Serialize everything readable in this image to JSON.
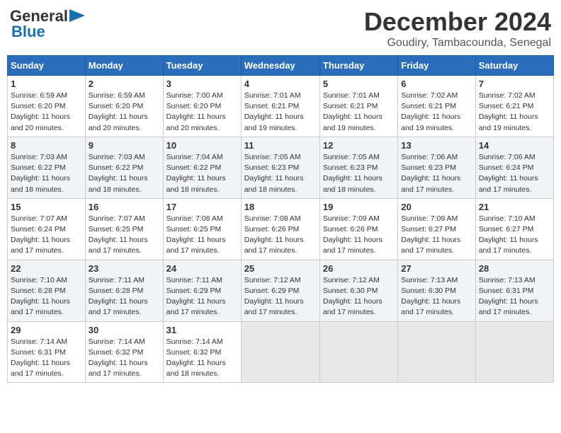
{
  "header": {
    "logo_general": "General",
    "logo_blue": "Blue",
    "month_title": "December 2024",
    "location": "Goudiry, Tambacounda, Senegal"
  },
  "days_of_week": [
    "Sunday",
    "Monday",
    "Tuesday",
    "Wednesday",
    "Thursday",
    "Friday",
    "Saturday"
  ],
  "weeks": [
    [
      {
        "day": "1",
        "sunrise": "6:59 AM",
        "sunset": "6:20 PM",
        "daylight": "11 hours and 20 minutes."
      },
      {
        "day": "2",
        "sunrise": "6:59 AM",
        "sunset": "6:20 PM",
        "daylight": "11 hours and 20 minutes."
      },
      {
        "day": "3",
        "sunrise": "7:00 AM",
        "sunset": "6:20 PM",
        "daylight": "11 hours and 20 minutes."
      },
      {
        "day": "4",
        "sunrise": "7:01 AM",
        "sunset": "6:21 PM",
        "daylight": "11 hours and 19 minutes."
      },
      {
        "day": "5",
        "sunrise": "7:01 AM",
        "sunset": "6:21 PM",
        "daylight": "11 hours and 19 minutes."
      },
      {
        "day": "6",
        "sunrise": "7:02 AM",
        "sunset": "6:21 PM",
        "daylight": "11 hours and 19 minutes."
      },
      {
        "day": "7",
        "sunrise": "7:02 AM",
        "sunset": "6:21 PM",
        "daylight": "11 hours and 19 minutes."
      }
    ],
    [
      {
        "day": "8",
        "sunrise": "7:03 AM",
        "sunset": "6:22 PM",
        "daylight": "11 hours and 18 minutes."
      },
      {
        "day": "9",
        "sunrise": "7:03 AM",
        "sunset": "6:22 PM",
        "daylight": "11 hours and 18 minutes."
      },
      {
        "day": "10",
        "sunrise": "7:04 AM",
        "sunset": "6:22 PM",
        "daylight": "11 hours and 18 minutes."
      },
      {
        "day": "11",
        "sunrise": "7:05 AM",
        "sunset": "6:23 PM",
        "daylight": "11 hours and 18 minutes."
      },
      {
        "day": "12",
        "sunrise": "7:05 AM",
        "sunset": "6:23 PM",
        "daylight": "11 hours and 18 minutes."
      },
      {
        "day": "13",
        "sunrise": "7:06 AM",
        "sunset": "6:23 PM",
        "daylight": "11 hours and 17 minutes."
      },
      {
        "day": "14",
        "sunrise": "7:06 AM",
        "sunset": "6:24 PM",
        "daylight": "11 hours and 17 minutes."
      }
    ],
    [
      {
        "day": "15",
        "sunrise": "7:07 AM",
        "sunset": "6:24 PM",
        "daylight": "11 hours and 17 minutes."
      },
      {
        "day": "16",
        "sunrise": "7:07 AM",
        "sunset": "6:25 PM",
        "daylight": "11 hours and 17 minutes."
      },
      {
        "day": "17",
        "sunrise": "7:08 AM",
        "sunset": "6:25 PM",
        "daylight": "11 hours and 17 minutes."
      },
      {
        "day": "18",
        "sunrise": "7:08 AM",
        "sunset": "6:26 PM",
        "daylight": "11 hours and 17 minutes."
      },
      {
        "day": "19",
        "sunrise": "7:09 AM",
        "sunset": "6:26 PM",
        "daylight": "11 hours and 17 minutes."
      },
      {
        "day": "20",
        "sunrise": "7:09 AM",
        "sunset": "6:27 PM",
        "daylight": "11 hours and 17 minutes."
      },
      {
        "day": "21",
        "sunrise": "7:10 AM",
        "sunset": "6:27 PM",
        "daylight": "11 hours and 17 minutes."
      }
    ],
    [
      {
        "day": "22",
        "sunrise": "7:10 AM",
        "sunset": "6:28 PM",
        "daylight": "11 hours and 17 minutes."
      },
      {
        "day": "23",
        "sunrise": "7:11 AM",
        "sunset": "6:28 PM",
        "daylight": "11 hours and 17 minutes."
      },
      {
        "day": "24",
        "sunrise": "7:11 AM",
        "sunset": "6:29 PM",
        "daylight": "11 hours and 17 minutes."
      },
      {
        "day": "25",
        "sunrise": "7:12 AM",
        "sunset": "6:29 PM",
        "daylight": "11 hours and 17 minutes."
      },
      {
        "day": "26",
        "sunrise": "7:12 AM",
        "sunset": "6:30 PM",
        "daylight": "11 hours and 17 minutes."
      },
      {
        "day": "27",
        "sunrise": "7:13 AM",
        "sunset": "6:30 PM",
        "daylight": "11 hours and 17 minutes."
      },
      {
        "day": "28",
        "sunrise": "7:13 AM",
        "sunset": "6:31 PM",
        "daylight": "11 hours and 17 minutes."
      }
    ],
    [
      {
        "day": "29",
        "sunrise": "7:14 AM",
        "sunset": "6:31 PM",
        "daylight": "11 hours and 17 minutes."
      },
      {
        "day": "30",
        "sunrise": "7:14 AM",
        "sunset": "6:32 PM",
        "daylight": "11 hours and 17 minutes."
      },
      {
        "day": "31",
        "sunrise": "7:14 AM",
        "sunset": "6:32 PM",
        "daylight": "11 hours and 18 minutes."
      },
      null,
      null,
      null,
      null
    ]
  ]
}
